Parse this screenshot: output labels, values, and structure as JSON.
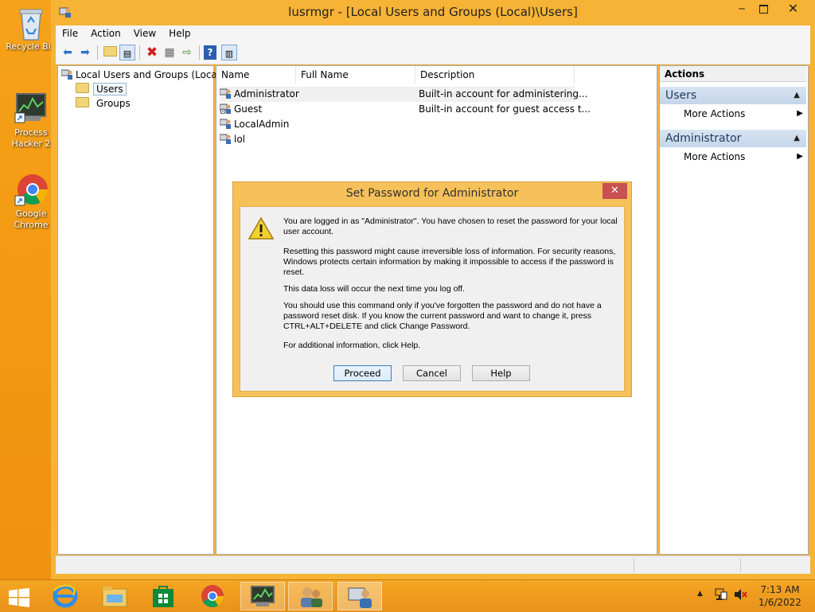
{
  "desktop": {
    "icons": [
      {
        "label": "Recycle Bin"
      },
      {
        "label": "Process Hacker 2"
      },
      {
        "label": "Google Chrome"
      }
    ]
  },
  "window": {
    "title": "lusrmgr - [Local Users and Groups (Local)\\Users]",
    "menu": [
      "File",
      "Action",
      "View",
      "Help"
    ],
    "tree": {
      "root": "Local Users and Groups (Local)",
      "children": [
        "Users",
        "Groups"
      ]
    },
    "list": {
      "columns": [
        "Name",
        "Full Name",
        "Description"
      ],
      "rows": [
        {
          "name": "Administrator",
          "full_name": "",
          "description": "Built-in account for administering..."
        },
        {
          "name": "Guest",
          "full_name": "",
          "description": "Built-in account for guest access t..."
        },
        {
          "name": "LocalAdmin",
          "full_name": "",
          "description": ""
        },
        {
          "name": "lol",
          "full_name": "",
          "description": ""
        }
      ]
    },
    "actions": {
      "title": "Actions",
      "groups": [
        {
          "label": "Users",
          "item": "More Actions"
        },
        {
          "label": "Administrator",
          "item": "More Actions"
        }
      ]
    }
  },
  "dialog": {
    "title": "Set Password for Administrator",
    "close": "✕",
    "paragraphs": [
      "You are logged in as \"Administrator\". You have chosen to reset the password for your local user account.",
      "Resetting this password might cause irreversible loss of information. For security reasons, Windows protects certain information by making it impossible to access if the password is reset.",
      "This data loss will occur the next time you log off.",
      "You should use this command only if you've forgotten the password and do not have a password reset disk. If you know the current password and want to change it, press CTRL+ALT+DELETE and click Change Password.",
      "For additional information, click Help."
    ],
    "buttons": {
      "proceed": "Proceed",
      "cancel": "Cancel",
      "help": "Help"
    }
  },
  "taskbar": {
    "time": "7:13 AM",
    "date": "1/6/2022"
  },
  "colors": {
    "desktop": "#f39a12",
    "window_frame": "#f6b335",
    "action_group": "#c5d6ea",
    "dialog_close": "#c75050"
  }
}
